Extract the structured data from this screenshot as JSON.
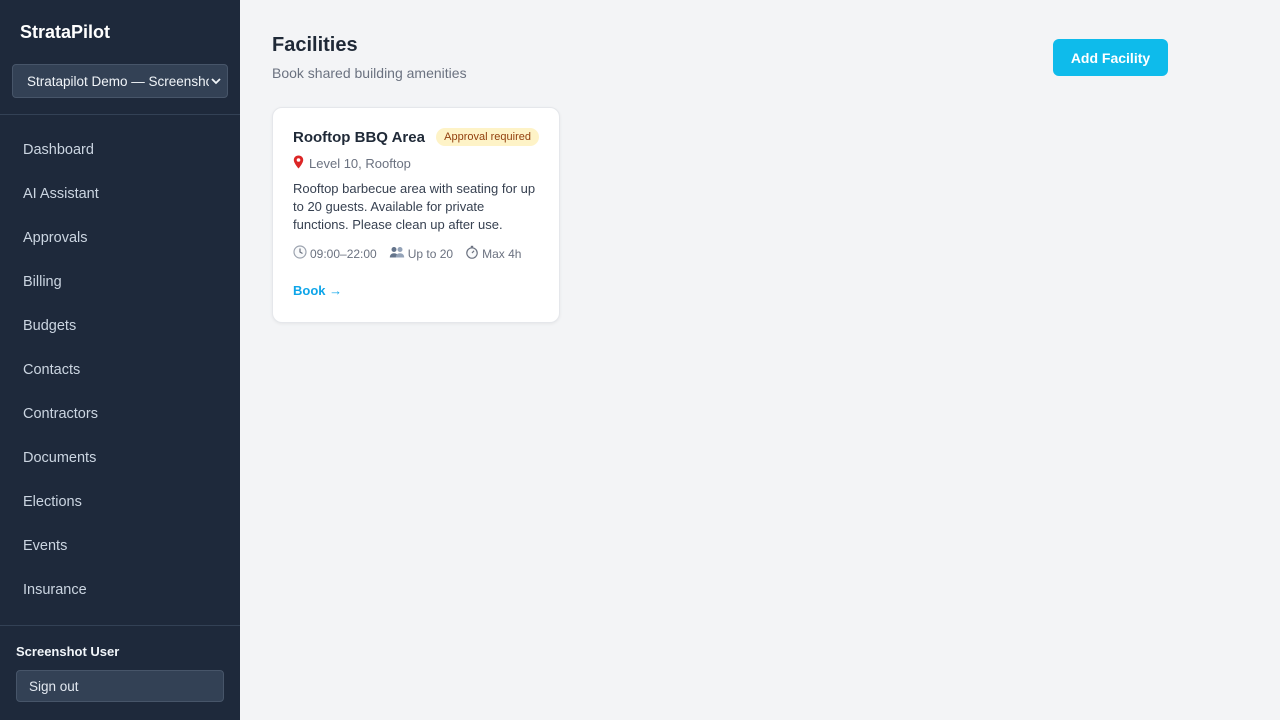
{
  "app": {
    "name": "StrataPilot"
  },
  "org_selector": {
    "value": "Stratapilot Demo — Screenshot"
  },
  "sidebar": {
    "items": [
      {
        "label": "Dashboard"
      },
      {
        "label": "AI Assistant"
      },
      {
        "label": "Approvals"
      },
      {
        "label": "Billing"
      },
      {
        "label": "Budgets"
      },
      {
        "label": "Contacts"
      },
      {
        "label": "Contractors"
      },
      {
        "label": "Documents"
      },
      {
        "label": "Elections"
      },
      {
        "label": "Events"
      },
      {
        "label": "Insurance"
      }
    ]
  },
  "user": {
    "name": "Screenshot User",
    "signout_label": "Sign out"
  },
  "page": {
    "title": "Facilities",
    "subtitle": "Book shared building amenities",
    "add_button_label": "Add Facility"
  },
  "facility": {
    "name": "Rooftop BBQ Area",
    "badge": "Approval required",
    "location": "Level 10, Rooftop",
    "description": "Rooftop barbecue area with seating for up to 20 guests. Available for private functions. Please clean up after use.",
    "hours": "09:00–22:00",
    "capacity": "Up to 20",
    "max_duration": "Max 4h",
    "book_label": "Book →",
    "icons": {
      "location": "map-pin-icon",
      "hours": "clock-icon",
      "capacity": "people-icon",
      "duration": "stopwatch-icon"
    }
  },
  "colors": {
    "sidebar_bg": "#1e293b",
    "accent": "#0ebbeb",
    "badge_bg": "#fef3c7",
    "badge_text": "#92400e"
  }
}
